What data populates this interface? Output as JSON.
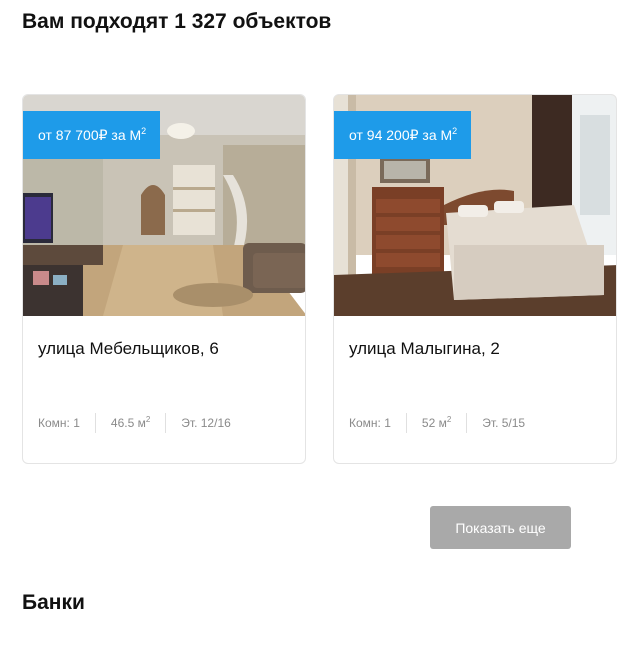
{
  "heading": "Вам подходят 1 327 объектов",
  "listings": [
    {
      "price_prefix": "от 87 700₽ за М",
      "price_unit_sup": "2",
      "address": "улица Мебельщиков, 6",
      "rooms": "Комн: 1",
      "area": "46.5 м",
      "area_sup": "2",
      "floor": "Эт. 12/16",
      "photo": "apartment-living-room-photo"
    },
    {
      "price_prefix": "от 94 200₽ за М",
      "price_unit_sup": "2",
      "address": "улица Малыгина, 2",
      "rooms": "Комн: 1",
      "area": "52 м",
      "area_sup": "2",
      "floor": "Эт. 5/15",
      "photo": "apartment-bedroom-photo"
    }
  ],
  "show_more_label": "Показать еще",
  "banks_heading": "Банки",
  "colors": {
    "badge": "#1e9be9",
    "button": "#a9a9a9",
    "spec_text": "#8a8a8a"
  }
}
